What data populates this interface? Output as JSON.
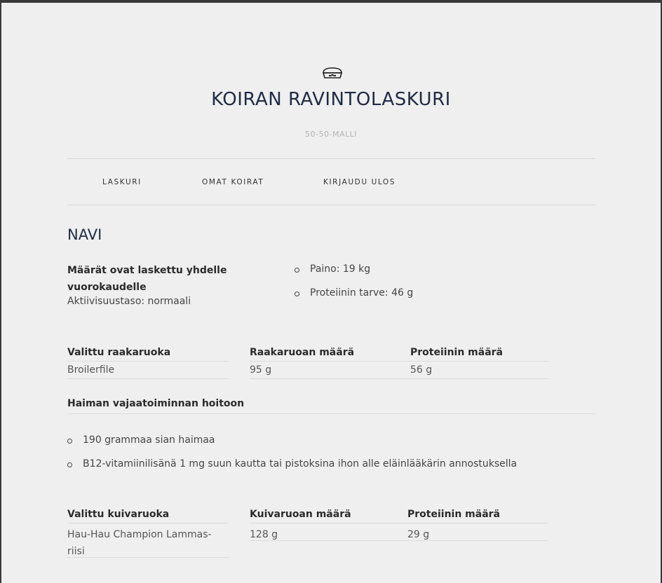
{
  "site": {
    "title": "KOIRAN RAVINTOLASKURI",
    "subtitle": "50-50-MALLI",
    "logo_icon": "dog-bowl-icon"
  },
  "nav": {
    "items": [
      {
        "label": "LASKURI"
      },
      {
        "label": "OMAT KOIRAT"
      },
      {
        "label": "KIRJAUDU ULOS"
      }
    ]
  },
  "dog": {
    "name": "NAVI",
    "intro": "Määrät ovat laskettu yhdelle vuorokaudelle",
    "activity": "Aktiivisuustaso: normaali",
    "stats": [
      {
        "text": "Paino: 19 kg"
      },
      {
        "text": "Proteiinin tarve: 46 g"
      }
    ]
  },
  "raw_table": {
    "headers": [
      "Valittu raakaruoka",
      "Raakaruoan määrä",
      "Proteiinin määrä"
    ],
    "row": [
      "Broilerfile",
      "95 g",
      "56 g"
    ]
  },
  "treatment": {
    "title": "Haiman vajaatoiminnan hoitoon",
    "items": [
      {
        "text": "190 grammaa sian haimaa"
      },
      {
        "text": "B12-vitamiinilisänä 1 mg suun kautta tai pistoksina ihon alle eläinlääkärin annostuksella"
      }
    ]
  },
  "dry_table": {
    "headers": [
      "Valittu kuivaruoka",
      "Kuivaruoan määrä",
      "Proteiinin määrä"
    ],
    "row": [
      "Hau-Hau Champion Lammas-riisi",
      "128 g",
      "29 g"
    ]
  }
}
